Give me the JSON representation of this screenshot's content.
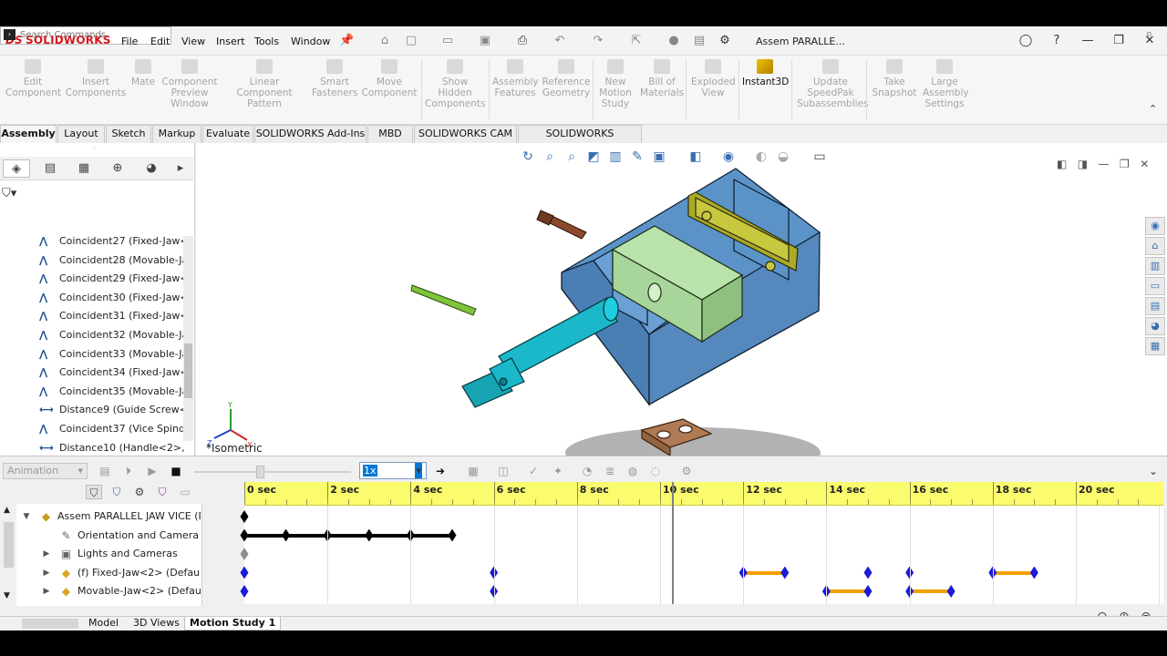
{
  "app": {
    "brand_ds": "DS",
    "brand": "SOLIDWORKS"
  },
  "menu": [
    "File",
    "Edit",
    "View",
    "Insert",
    "Tools",
    "Window"
  ],
  "document_title": "Assem PARALLE...",
  "search": {
    "placeholder": "Search Commands"
  },
  "commands": [
    {
      "label": "Edit\nComponent"
    },
    {
      "label": "Insert\nComponents"
    },
    {
      "label": "Mate"
    },
    {
      "label": "Component\nPreview\nWindow"
    },
    {
      "label": "Linear Component\nPattern"
    },
    {
      "label": "Smart\nFasteners"
    },
    {
      "label": "Move\nComponent"
    },
    {
      "label": "Show\nHidden\nComponents"
    },
    {
      "label": "Assembly\nFeatures"
    },
    {
      "label": "Reference\nGeometry"
    },
    {
      "label": "New\nMotion\nStudy"
    },
    {
      "label": "Bill of\nMaterials"
    },
    {
      "label": "Exploded\nView"
    },
    {
      "label": "Instant3D"
    },
    {
      "label": "Update\nSpeedPak\nSubassemblies"
    },
    {
      "label": "Take\nSnapshot"
    },
    {
      "label": "Large\nAssembly\nSettings"
    }
  ],
  "tabs": [
    "Assembly",
    "Layout",
    "Sketch",
    "Markup",
    "Evaluate",
    "SOLIDWORKS Add-Ins",
    "MBD",
    "SOLIDWORKS CAM",
    "SOLIDWORKS Inspection"
  ],
  "feature_tree": [
    {
      "label": "Coincident27 (Fixed-Jaw<2",
      "type": "coincident"
    },
    {
      "label": "Coincident28 (Movable-Jav",
      "type": "coincident"
    },
    {
      "label": "Coincident29 (Fixed-Jaw<2",
      "type": "coincident"
    },
    {
      "label": "Coincident30 (Fixed-Jaw<2",
      "type": "coincident"
    },
    {
      "label": "Coincident31 (Fixed-Jaw<2",
      "type": "coincident"
    },
    {
      "label": "Coincident32 (Movable-Jav",
      "type": "coincident"
    },
    {
      "label": "Coincident33 (Movable-Jav",
      "type": "coincident"
    },
    {
      "label": "Coincident34 (Fixed-Jaw<2",
      "type": "coincident"
    },
    {
      "label": "Coincident35 (Movable-Jav",
      "type": "coincident"
    },
    {
      "label": "Distance9 (Guide Screw<2>",
      "type": "distance"
    },
    {
      "label": "Coincident37 (Vice Spindle",
      "type": "coincident"
    },
    {
      "label": "Distance10 (Handle<2>,Vic",
      "type": "distance"
    },
    {
      "label": "Coincident42 (Fixed-Jaw<",
      "type": "coincident"
    }
  ],
  "view_label": "*Isometric",
  "motion": {
    "study_type": "Animation",
    "playback_speed": "1x",
    "time_labels": [
      "0 sec",
      "2 sec",
      "4 sec",
      "6 sec",
      "8 sec",
      "10 sec",
      "12 sec",
      "14 sec",
      "16 sec",
      "18 sec",
      "20 sec"
    ],
    "playhead_sec": 10.3,
    "rows": [
      {
        "label": "Assem PARALLEL JAW VICE (De",
        "indent": 0,
        "expand": "▼",
        "icon": "assembly-icon",
        "keys": [
          {
            "t": 0,
            "c": "black"
          }
        ],
        "bars": []
      },
      {
        "label": "Orientation and Camera Vi",
        "indent": 1,
        "expand": "",
        "icon": "camera-icon",
        "keys": [
          {
            "t": 0,
            "c": "black"
          },
          {
            "t": 1,
            "c": "black"
          },
          {
            "t": 2,
            "c": "black"
          },
          {
            "t": 3,
            "c": "black"
          },
          {
            "t": 4,
            "c": "black"
          },
          {
            "t": 5,
            "c": "black"
          }
        ],
        "bars": [
          {
            "from": 0,
            "to": 5,
            "c": "black"
          }
        ]
      },
      {
        "label": "Lights and Cameras",
        "indent": 1,
        "expand": "▶",
        "icon": "lights-icon",
        "keys": [
          {
            "t": 0,
            "c": "gray"
          }
        ],
        "bars": []
      },
      {
        "label": "(f) Fixed-Jaw<2> (Default)",
        "indent": 1,
        "expand": "▶",
        "icon": "part-icon",
        "keys": [
          {
            "t": 0,
            "c": "blue"
          },
          {
            "t": 6,
            "c": "blue"
          },
          {
            "t": 12,
            "c": "blue"
          },
          {
            "t": 13,
            "c": "blue"
          },
          {
            "t": 15,
            "c": "blue"
          },
          {
            "t": 16,
            "c": "blue"
          },
          {
            "t": 18,
            "c": "blue"
          },
          {
            "t": 19,
            "c": "blue"
          }
        ],
        "bars": [
          {
            "from": 12,
            "to": 13,
            "c": "orange"
          },
          {
            "from": 18,
            "to": 19,
            "c": "orange"
          }
        ]
      },
      {
        "label": "Movable-Jaw<2> (Default)",
        "indent": 1,
        "expand": "▶",
        "icon": "part-icon",
        "keys": [
          {
            "t": 0,
            "c": "blue"
          },
          {
            "t": 6,
            "c": "blue"
          },
          {
            "t": 14,
            "c": "blue"
          },
          {
            "t": 15,
            "c": "blue"
          },
          {
            "t": 16,
            "c": "blue"
          },
          {
            "t": 17,
            "c": "blue"
          }
        ],
        "bars": [
          {
            "from": 14,
            "to": 15,
            "c": "orange"
          },
          {
            "from": 16,
            "to": 17,
            "c": "orange"
          }
        ]
      }
    ]
  },
  "bottom_tabs": [
    "Model",
    "3D Views",
    "Motion Study 1"
  ],
  "colors": {
    "body": "#5b93c8",
    "jaw": "#a9a92a",
    "block": "#a8d59a",
    "spindle": "#1ab8c8",
    "pin": "#7fc43a",
    "screw": "#8b4a2b",
    "plate": "#b07a55",
    "ruler": "#fbfb6e",
    "key_blue": "#1a1ad8",
    "bar_orange": "#f2a000"
  }
}
